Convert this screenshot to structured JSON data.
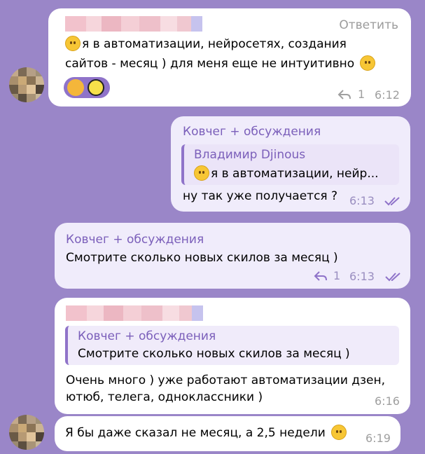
{
  "messages": [
    {
      "reply_label": "Ответить",
      "text_line1": "я в автоматизации, нейросетях, создания",
      "text_line2": "сайтов - месяц )  для меня еще не интуитивно",
      "replies_count": "1",
      "time": "6:12"
    },
    {
      "sender": "Ковчег + обсуждения",
      "quote_name": "Владимир Djinous",
      "quote_text": "я в автоматизации, нейр...",
      "text": "ну так уже получается ?",
      "time": "6:13"
    },
    {
      "sender": "Ковчег + обсуждения",
      "text": "Смотрите сколько новых скилов за месяц )",
      "replies_count": "1",
      "time": "6:13"
    },
    {
      "quote_name": "Ковчег + обсуждения",
      "quote_text": "Смотрите сколько новых скилов за месяц )",
      "text_line1": "Очень много ) уже работают автоматизации дзен,",
      "text_line2": "ютюб, телега, одноклассники )",
      "time": "6:16"
    },
    {
      "text": "Я бы даже сказал не месяц, а 2,5 недели",
      "time": "6:19"
    }
  ],
  "colors": {
    "background": "#9a86c8",
    "incoming_bubble": "#ffffff",
    "outgoing_bubble": "#f0ecfb",
    "accent": "#7b5fba"
  }
}
